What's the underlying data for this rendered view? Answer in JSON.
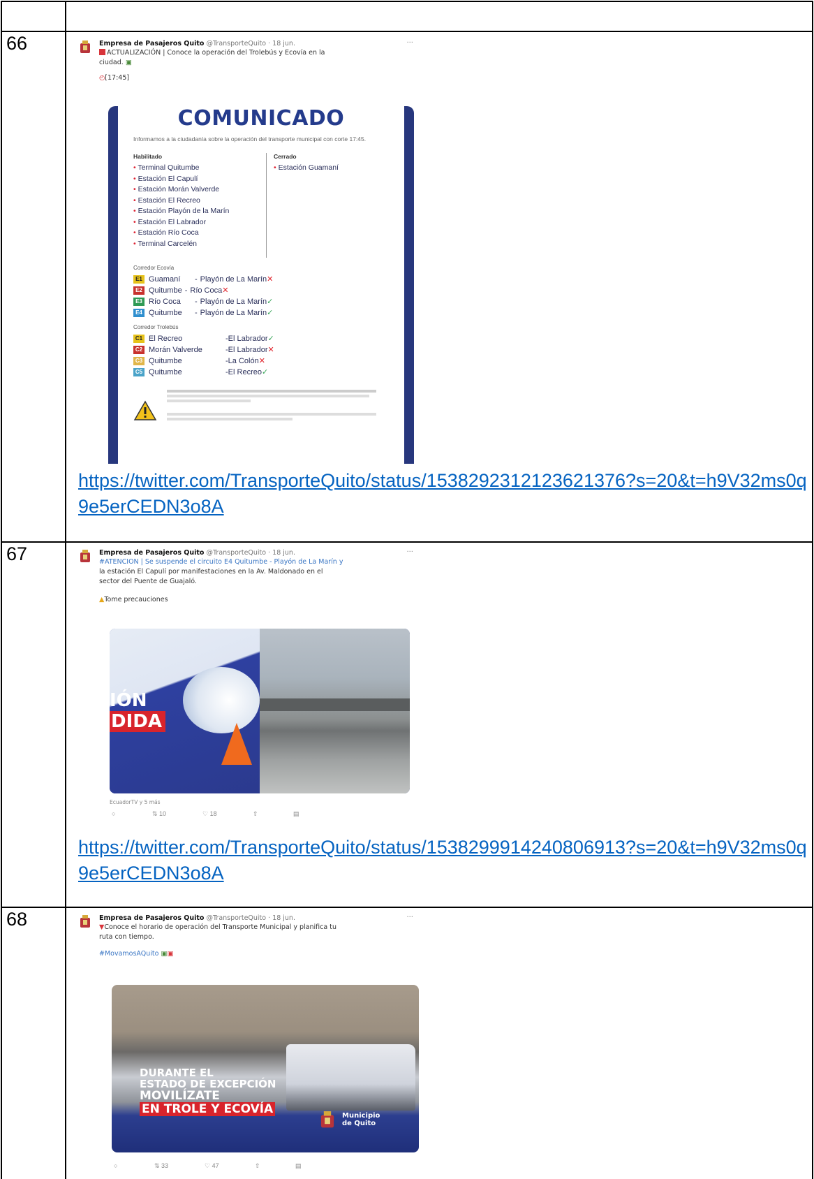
{
  "rows": [
    {
      "number": "66",
      "tweet": {
        "author": "Empresa de Pasajeros Quito",
        "handle": "@TransporteQuito · 18 jun.",
        "text_lines": [
          "ACTUALIZACIÓN | Conoce la operación del Trolebús y Ecovía en la",
          "ciudad."
        ],
        "time": "[17:45]"
      },
      "comunicado": {
        "title": "COMUNICADO",
        "subtitle": "Informamos a la ciudadanía sobre la operación del transporte municipal con corte 17:45.",
        "habilitado_title": "Habilitado",
        "habilitado": [
          "Terminal Quitumbe",
          "Estación El Capulí",
          "Estación Morán Valverde",
          "Estación El Recreo",
          "Estación Playón de la Marín",
          "Estación El Labrador",
          "Estación Río Coca",
          "Terminal Carcelén"
        ],
        "cerrado_title": "Cerrado",
        "cerrado": [
          "Estación Guamaní"
        ],
        "ecovia_title": "Corredor Ecovía",
        "ecovia": [
          {
            "code": "E1",
            "from": "Guamaní",
            "to": "Playón de La Marín",
            "ok": false,
            "color": "#e6c21a"
          },
          {
            "code": "E2",
            "from": "Quitumbe",
            "to": "Río Coca",
            "ok": false,
            "color": "#c8322e"
          },
          {
            "code": "E3",
            "from": "Río Coca",
            "to": "Playón de La Marín",
            "ok": true,
            "color": "#2e9a55"
          },
          {
            "code": "E4",
            "from": "Quitumbe",
            "to": "Playón de La Marín",
            "ok": true,
            "color": "#2f8fcf"
          }
        ],
        "trole_title": "Corredor Trolebús",
        "trole": [
          {
            "code": "C1",
            "from": "El Recreo",
            "to": "El Labrador",
            "ok": true,
            "color": "#e6c21a"
          },
          {
            "code": "C2",
            "from": "Morán Valverde",
            "to": "El Labrador",
            "ok": false,
            "color": "#c8322e"
          },
          {
            "code": "C3",
            "from": "Quitumbe",
            "to": "La Colón",
            "ok": false,
            "color": "#e0b64a"
          },
          {
            "code": "C5",
            "from": "Quitumbe",
            "to": "El Recreo",
            "ok": true,
            "color": "#4aa3c9"
          }
        ]
      },
      "link": "https://twitter.com/TransporteQuito/status/1538292312123621376?s=20&t=h9V32ms0q9e5erCEDN3o8A"
    },
    {
      "number": "67",
      "tweet": {
        "author": "Empresa de Pasajeros Quito",
        "handle": "@TransporteQuito · 18 jun.",
        "text_lines": [
          "#ATENCION | Se suspende el circuito E4 Quitumbe - Playón de La Marín y",
          "la estación El Capulí por manifestaciones en la Av. Maldonado en el",
          "sector del Puente de Guajaló."
        ],
        "extra": "Tome precauciones",
        "image_text": [
          "IÓN",
          "DIDA"
        ],
        "caption": "EcuadorTV y 5 más",
        "retweets": "10",
        "likes": "18"
      },
      "link": "https://twitter.com/TransporteQuito/status/1538299914240806913?s=20&t=h9V32ms0q9e5erCEDN3o8A"
    },
    {
      "number": "68",
      "tweet": {
        "author": "Empresa de Pasajeros Quito",
        "handle": "@TransporteQuito · 18 jun.",
        "text_lines": [
          "Conoce el horario de operación del Transporte Municipal y planifica tu",
          "ruta con tiempo."
        ],
        "hashtag": "#MovamosAQuito",
        "image_text": [
          "DURANTE EL",
          "ESTADO DE EXCEPCIÓN",
          "MOVILÍZATE",
          "EN TROLE Y ECOVÍA"
        ],
        "municipio": [
          "Municipio",
          "de Quito"
        ],
        "retweets": "33",
        "likes": "47"
      }
    }
  ],
  "colors": {
    "link": "#0563c1",
    "brand_blue": "#243b8c"
  }
}
